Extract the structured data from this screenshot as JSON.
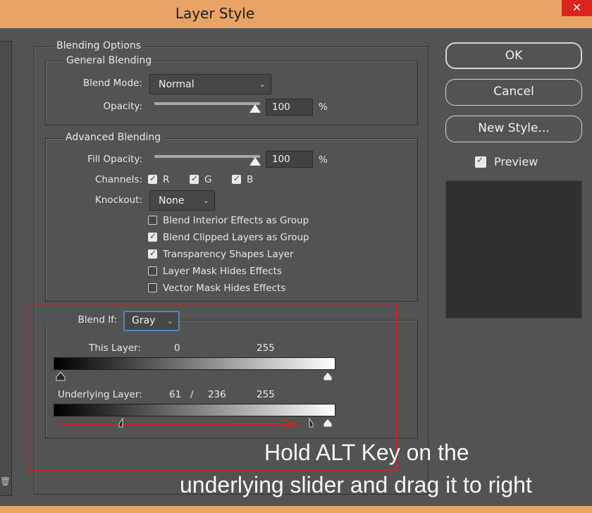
{
  "window": {
    "title": "Layer Style",
    "close_glyph": "✕"
  },
  "blending_options": {
    "legend": "Blending Options",
    "general": {
      "legend": "General Blending",
      "blend_mode_label": "Blend Mode:",
      "blend_mode_value": "Normal",
      "opacity_label": "Opacity:",
      "opacity_value": "100",
      "opacity_unit": "%",
      "opacity_level": 1.0
    },
    "advanced": {
      "legend": "Advanced Blending",
      "fill_opacity_label": "Fill Opacity:",
      "fill_opacity_value": "100",
      "fill_opacity_unit": "%",
      "fill_opacity_level": 1.0,
      "channels_label": "Channels:",
      "channels": [
        {
          "label": "R",
          "checked": true
        },
        {
          "label": "G",
          "checked": true
        },
        {
          "label": "B",
          "checked": true
        }
      ],
      "knockout_label": "Knockout:",
      "knockout_value": "None",
      "options": [
        {
          "label": "Blend Interior Effects as Group",
          "checked": false
        },
        {
          "label": "Blend Clipped Layers as Group",
          "checked": true
        },
        {
          "label": "Transparency Shapes Layer",
          "checked": true
        },
        {
          "label": "Layer Mask Hides Effects",
          "checked": false
        },
        {
          "label": "Vector Mask Hides Effects",
          "checked": false
        }
      ]
    },
    "blend_if": {
      "label": "Blend If:",
      "value": "Gray",
      "this_layer_label": "This Layer:",
      "this_layer_low": "0",
      "this_layer_high": "255",
      "underlying_label": "Underlying Layer:",
      "underlying_low": "61",
      "underlying_sep": "/",
      "underlying_mid": "236",
      "underlying_high": "255"
    }
  },
  "buttons": {
    "ok": "OK",
    "cancel": "Cancel",
    "new_style": "New Style..."
  },
  "preview": {
    "label": "Preview",
    "checked": true
  },
  "annotation": {
    "line1": "Hold ALT Key on the",
    "line2": "underlying slider and drag it to right",
    "highlight_color": "#c8232a",
    "arrow_color": "#c02a2a"
  },
  "colors": {
    "titlebar": "#e8a365",
    "background": "#535353",
    "close": "#d9251b"
  }
}
